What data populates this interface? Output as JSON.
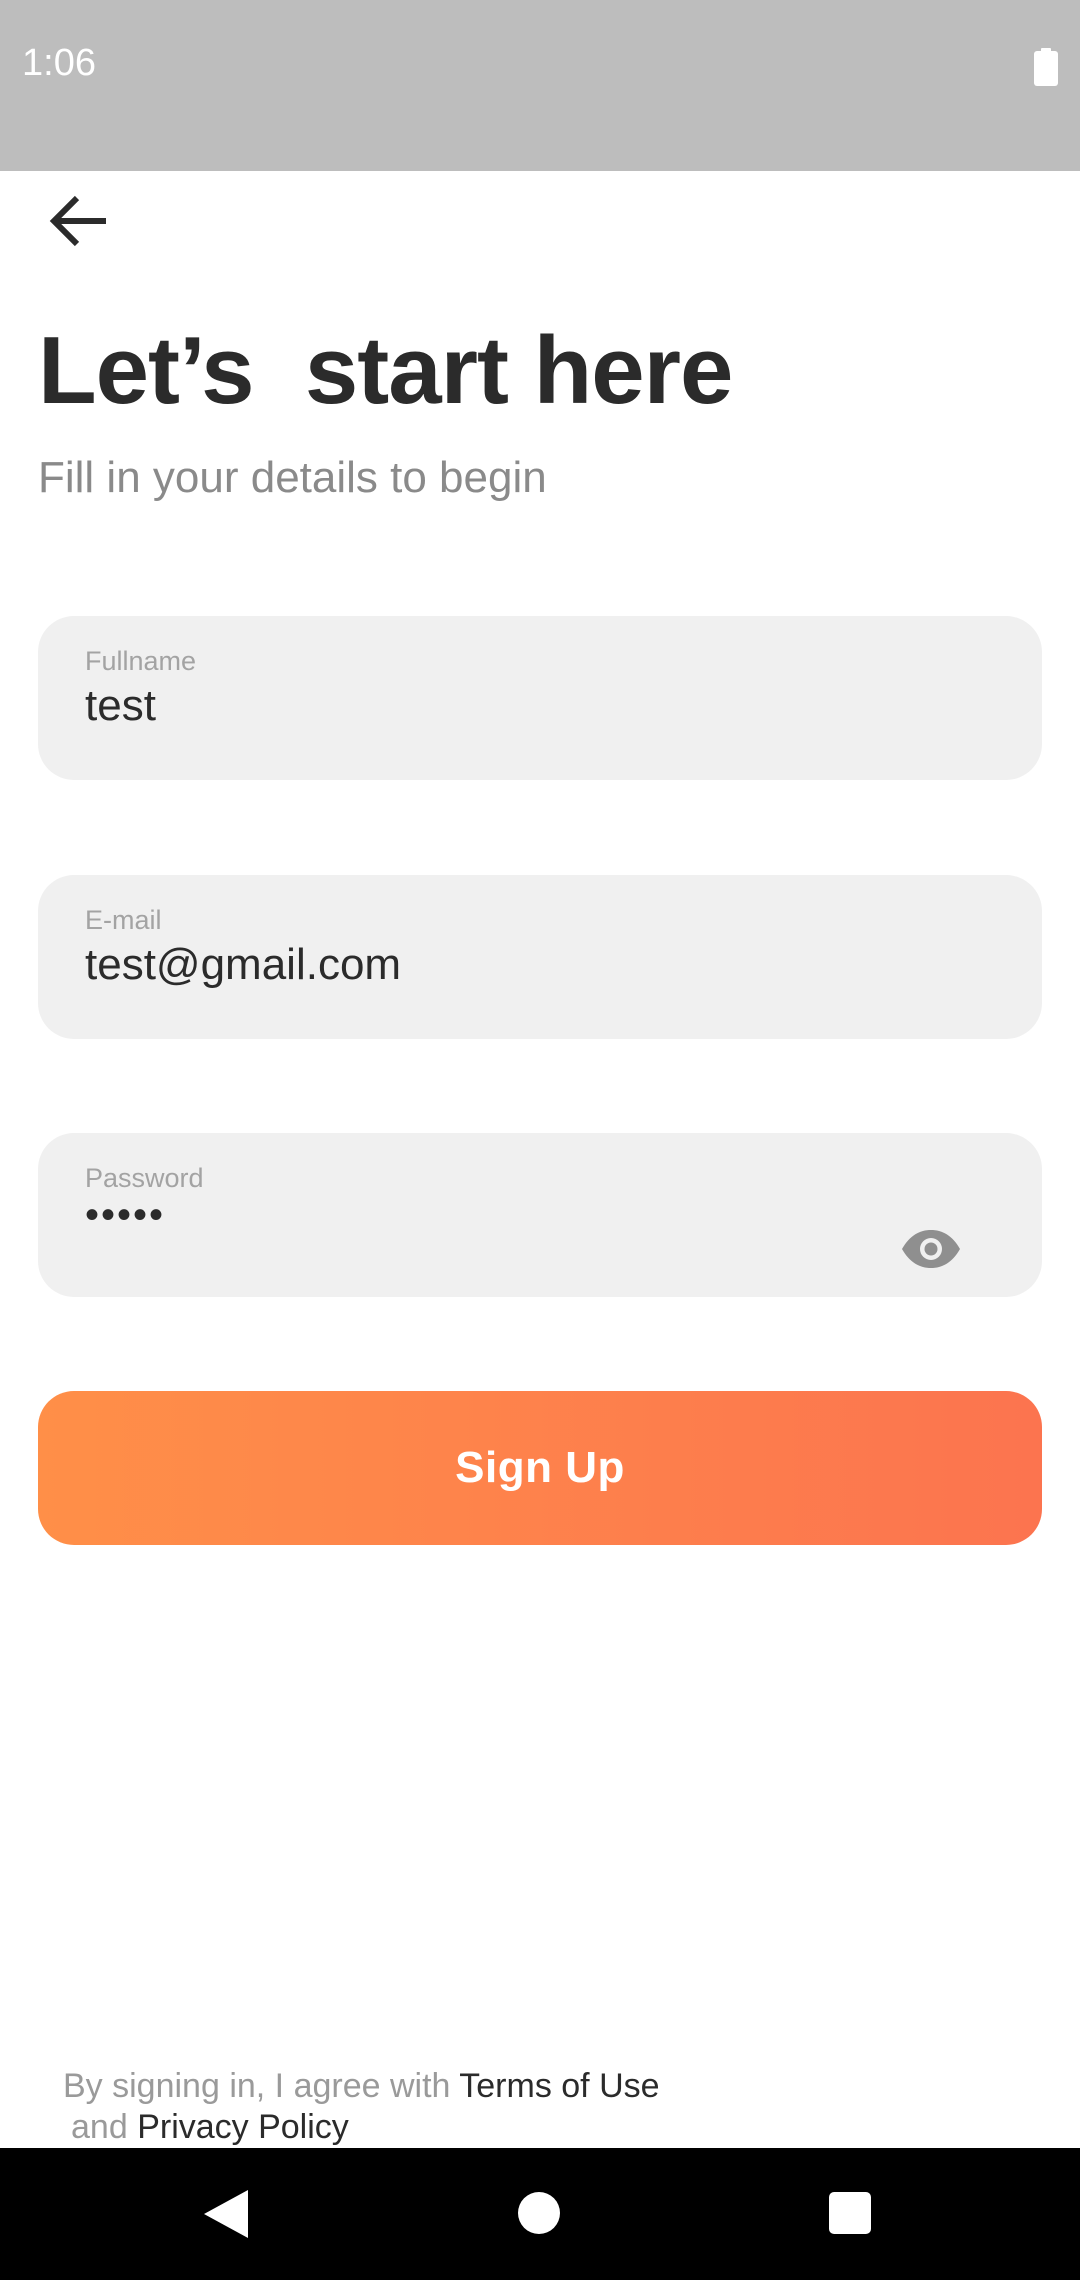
{
  "status_bar": {
    "time": "1:06",
    "battery_icon": "battery-full-icon"
  },
  "header": {
    "back_icon": "arrow-left-icon"
  },
  "title": "Let’s  start here",
  "subtitle": "Fill in your details to begin",
  "form": {
    "fullname": {
      "label": "Fullname",
      "value": "test"
    },
    "email": {
      "label": "E-mail",
      "value": "test@gmail.com"
    },
    "password": {
      "label": "Password",
      "value": "•••••",
      "toggle_icon": "eye-icon"
    }
  },
  "signup_button": {
    "label": "Sign Up",
    "gradient_start": "#ff8f48",
    "gradient_end": "#fc744f"
  },
  "legal": {
    "prefix": "By signing in, I agree with ",
    "terms_link": "Terms of Use",
    "conjunction": "and ",
    "privacy_link": "Privacy Policy"
  },
  "nav_bar": {
    "back_icon": "triangle-back-icon",
    "home_icon": "circle-home-icon",
    "recents_icon": "square-recents-icon"
  },
  "colors": {
    "status_bar": "#bdbdbd",
    "field_background": "#f0f0f0",
    "title_text": "#2b2b2b",
    "muted_text": "#8a8a8a"
  }
}
